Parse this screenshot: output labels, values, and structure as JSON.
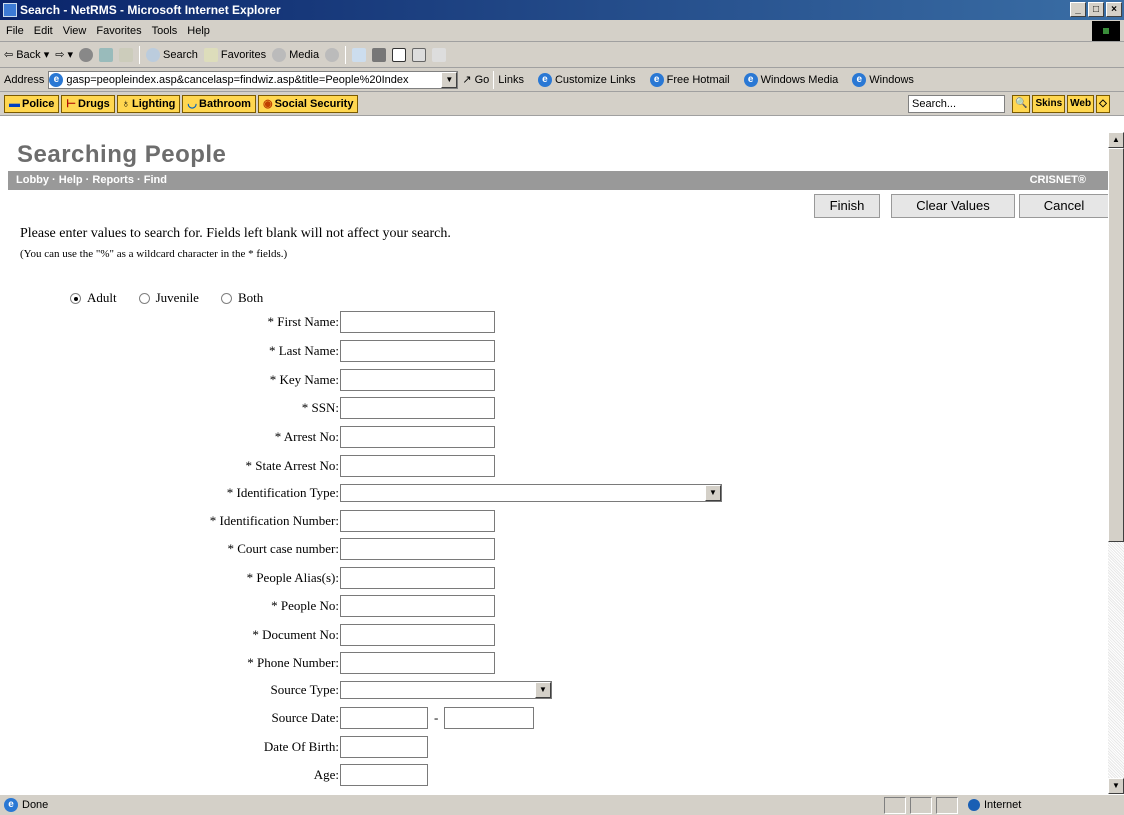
{
  "window": {
    "title": "Search - NetRMS - Microsoft Internet Explorer",
    "buttons": [
      "_",
      "□",
      "×"
    ]
  },
  "menu": [
    "File",
    "Edit",
    "View",
    "Favorites",
    "Tools",
    "Help"
  ],
  "toolbar": {
    "back": "Back",
    "search": "Search",
    "favorites": "Favorites",
    "media": "Media"
  },
  "address": {
    "label": "Address",
    "url": "gasp=peopleindex.asp&cancelasp=findwiz.asp&title=People%20Index",
    "go": "Go"
  },
  "links": {
    "label": "Links",
    "items": [
      "Customize Links",
      "Free Hotmail",
      "Windows Media",
      "Windows"
    ]
  },
  "linksbar": {
    "buttons": [
      "Police",
      "Drugs",
      "Lighting",
      "Bathroom",
      "Social Security"
    ],
    "search_placeholder": "Search...",
    "skins": "Skins",
    "web": "Web"
  },
  "page": {
    "title": "Searching People",
    "nav": "Lobby · Help · Reports · Find",
    "brand": "CRISNET®",
    "buttons": {
      "finish": "Finish",
      "clear": "Clear Values",
      "cancel": "Cancel"
    },
    "intro": "Please enter values to search for. Fields left blank will not affect your search.",
    "note": "(You can use the \"%\" as a wildcard character in the * fields.)",
    "radios": {
      "adult": "Adult",
      "juvenile": "Juvenile",
      "both": "Both",
      "selected": "Adult"
    }
  },
  "fields": {
    "first_name": "* First Name:",
    "last_name": "* Last Name:",
    "key_name": "* Key Name:",
    "ssn": "* SSN:",
    "arrest_no": "* Arrest No:",
    "state_arrest_no": "* State Arrest No:",
    "id_type": "* Identification Type:",
    "id_number": "* Identification Number:",
    "court_case": "* Court case number:",
    "alias": "* People Alias(s):",
    "people_no": "* People No:",
    "document_no": "* Document No:",
    "phone": "* Phone Number:",
    "source_type": "Source Type:",
    "source_date": "Source Date:",
    "source_date_sep": "-",
    "dob": "Date Of Birth:",
    "age": "Age:"
  },
  "status": {
    "text": "Done",
    "zone": "Internet"
  }
}
